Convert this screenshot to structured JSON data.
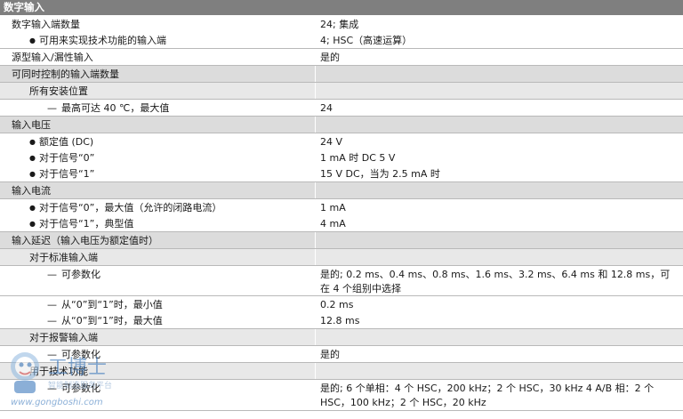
{
  "header": "数字输入",
  "rows": [
    {
      "id": "r1",
      "style": "lv0",
      "bullet": "",
      "label": "数字输入端数量",
      "value": "24; 集成",
      "h": 18,
      "plain": true
    },
    {
      "id": "r2",
      "style": "lv1",
      "bullet": "bullet",
      "label": "可用来实现技术功能的输入端",
      "value": "4; HSC（高速运算）",
      "h": 19
    },
    {
      "id": "r3",
      "style": "lv0",
      "bullet": "",
      "label": "源型输入/漏性输入",
      "value": "是的",
      "h": 19
    },
    {
      "id": "r4",
      "style": "sec",
      "bullet": "",
      "label": "可同时控制的输入端数量",
      "value": "",
      "h": 19
    },
    {
      "id": "r5",
      "style": "sub",
      "bullet": "",
      "label": "所有安装位置",
      "value": "",
      "h": 19
    },
    {
      "id": "r6",
      "style": "lv2",
      "bullet": "dash",
      "label": "最高可达 40 ℃，最大值",
      "value": "24",
      "h": 19
    },
    {
      "id": "r7",
      "style": "sec",
      "bullet": "",
      "label": "输入电压",
      "value": "",
      "h": 19
    },
    {
      "id": "r8",
      "style": "lv1",
      "bullet": "bullet",
      "label": "额定值 (DC)",
      "value": "24 V",
      "h": 18,
      "plain": true
    },
    {
      "id": "r9",
      "style": "lv1",
      "bullet": "bullet",
      "label": "对于信号“0”",
      "value": "1 mA 时 DC 5 V",
      "h": 18,
      "plain": true
    },
    {
      "id": "r10",
      "style": "lv1",
      "bullet": "bullet",
      "label": "对于信号“1”",
      "value": "15 V DC，当为 2.5 mA 时",
      "h": 19
    },
    {
      "id": "r11",
      "style": "sec",
      "bullet": "",
      "label": "输入电流",
      "value": "",
      "h": 19
    },
    {
      "id": "r12",
      "style": "lv1",
      "bullet": "bullet",
      "label": "对于信号“0”，最大值（允许的闭路电流）",
      "value": "1 mA",
      "h": 18,
      "plain": true
    },
    {
      "id": "r13",
      "style": "lv1",
      "bullet": "bullet",
      "label": "对于信号“1”，典型值",
      "value": "4 mA",
      "h": 19
    },
    {
      "id": "r14",
      "style": "sec",
      "bullet": "",
      "label": "输入延迟（输入电压为额定值时）",
      "value": "",
      "h": 19
    },
    {
      "id": "r15",
      "style": "sub",
      "bullet": "",
      "label": "对于标准输入端",
      "value": "",
      "h": 19
    },
    {
      "id": "r16",
      "style": "lv2",
      "bullet": "dash",
      "label": "可参数化",
      "value": "是的; 0.2 ms、0.4 ms、0.8 ms、1.6 ms、3.2 ms、6.4 ms 和 12.8 ms，可在 4 个组别中选择",
      "h": 34
    },
    {
      "id": "r17",
      "style": "lv2",
      "bullet": "dash",
      "label": "从“0”到“1”时，最小值",
      "value": "0.2 ms",
      "h": 18,
      "plain": true
    },
    {
      "id": "r18",
      "style": "lv2",
      "bullet": "dash",
      "label": "从“0”到“1”时，最大值",
      "value": "12.8 ms",
      "h": 19
    },
    {
      "id": "r19",
      "style": "sub",
      "bullet": "",
      "label": "对于报警输入端",
      "value": "",
      "h": 19
    },
    {
      "id": "r20",
      "style": "lv2",
      "bullet": "dash",
      "label": "可参数化",
      "value": "是的",
      "h": 19
    },
    {
      "id": "r21",
      "style": "sub",
      "bullet": "",
      "label": "用于技术功能",
      "value": "",
      "h": 19
    },
    {
      "id": "r22",
      "style": "lv2",
      "bullet": "dash",
      "label": "可参数化",
      "value": "是的; 6 个单相：4 个 HSC，200 kHz；2 个 HSC，30 kHz 4 A/B 相：2 个 HSC，100 kHz；2 个 HSC，20 kHz",
      "h": 35
    }
  ],
  "watermark": {
    "text": "www.gongboshi.com",
    "brand": "工博士",
    "tagline": "智能制造服务平台"
  }
}
